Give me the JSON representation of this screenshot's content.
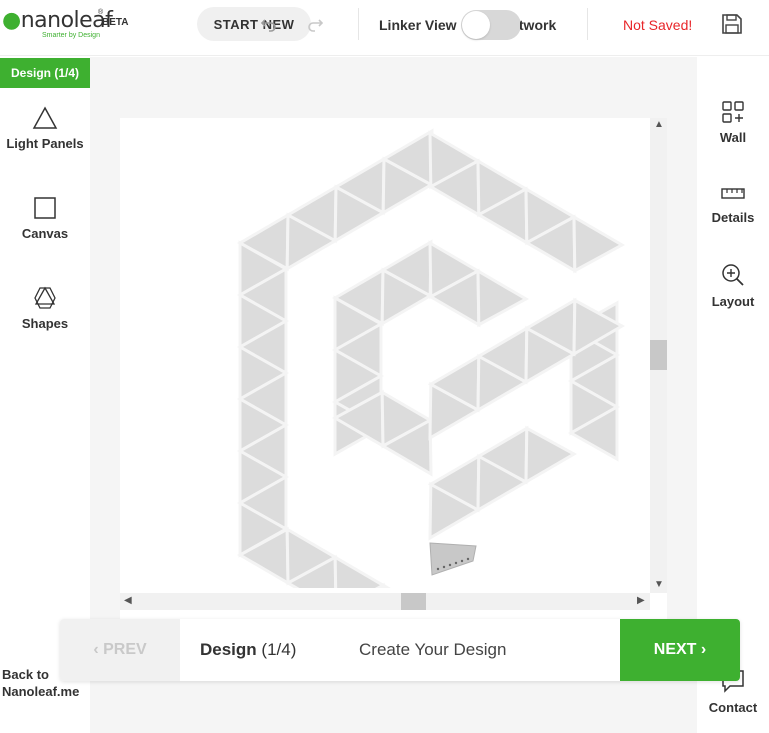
{
  "brand": {
    "name": "nanoleaf",
    "tagline": "Smarter by Design",
    "badge": "BETA"
  },
  "header": {
    "start_new": "START NEW",
    "linker_view": "Linker View",
    "network_label": "Network",
    "save_status": "Not Saved!"
  },
  "left_sidebar": {
    "step_badge": "Design (1/4)",
    "items": [
      {
        "label": "Light Panels",
        "icon": "triangle-icon"
      },
      {
        "label": "Canvas",
        "icon": "square-icon"
      },
      {
        "label": "Shapes",
        "icon": "shapes-icon"
      }
    ],
    "back_link": "Back to Nanoleaf.me"
  },
  "right_sidebar": {
    "items": [
      {
        "label": "Wall",
        "icon": "wall-grid-icon"
      },
      {
        "label": "Details",
        "icon": "ruler-icon"
      },
      {
        "label": "Layout",
        "icon": "zoom-in-icon"
      }
    ],
    "contact": "Contact"
  },
  "step_bar": {
    "prev": "PREV",
    "step_name": "Design",
    "step_count": "(1/4)",
    "description": "Create Your Design",
    "next": "NEXT"
  },
  "colors": {
    "accent_green": "#3eb030",
    "unsaved_red": "#e8262a",
    "panel_fill": "#dcdcdc",
    "panel_edge": "#f4f4f4"
  }
}
